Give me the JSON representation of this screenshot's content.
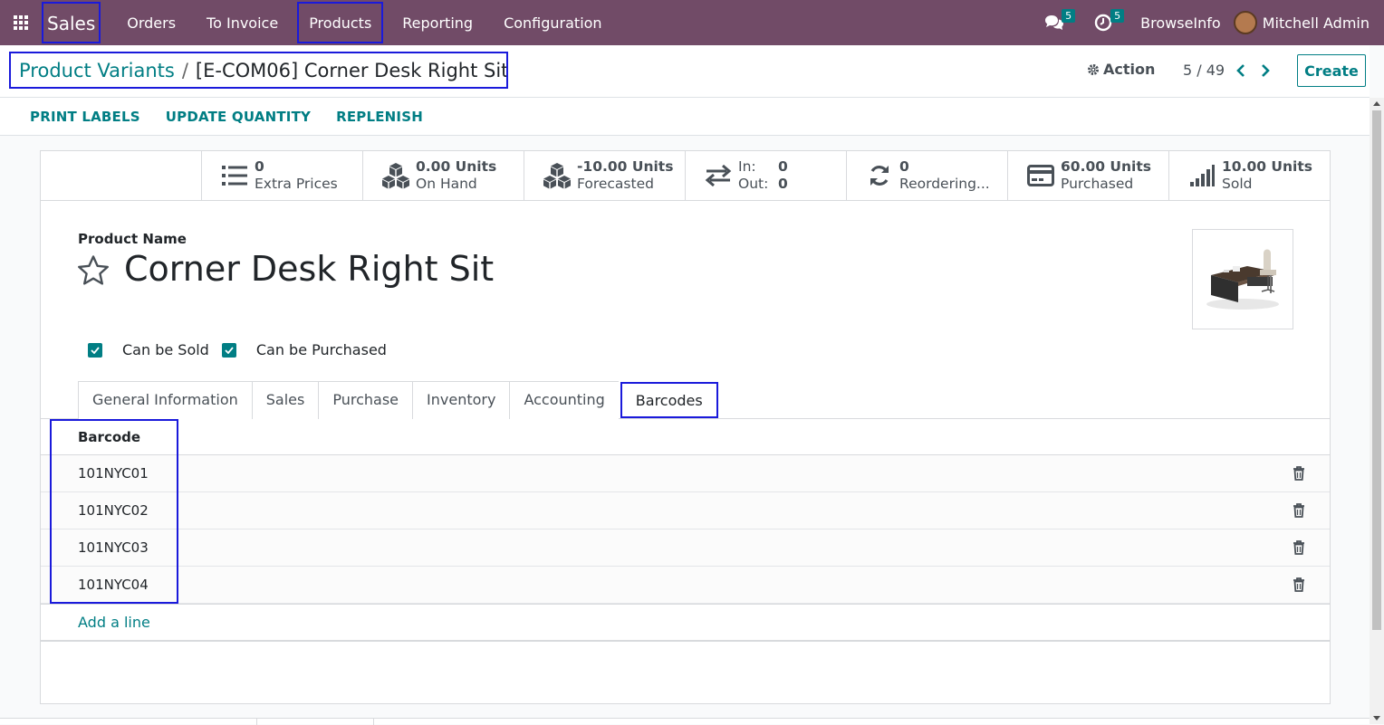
{
  "topbar": {
    "app_name": "Sales",
    "menu": [
      "Orders",
      "To Invoice",
      "Products",
      "Reporting",
      "Configuration"
    ],
    "messages_count": "5",
    "activities_count": "5",
    "company": "BrowseInfo",
    "user": "Mitchell Admin"
  },
  "control": {
    "breadcrumb_parent": "Product Variants",
    "breadcrumb_sep": "/",
    "breadcrumb_current": "[E-COM06] Corner Desk Right Sit",
    "action_label": "Action",
    "pager": "5 / 49",
    "create_label": "Create"
  },
  "statusbar": {
    "buttons": [
      "PRINT LABELS",
      "UPDATE QUANTITY",
      "REPLENISH"
    ]
  },
  "smart_buttons": [
    {
      "icon": "list-icon",
      "value": "0",
      "label": "Extra Prices"
    },
    {
      "icon": "cubes-icon",
      "value": "0.00 Units",
      "label": "On Hand"
    },
    {
      "icon": "cubes-icon",
      "value": "-10.00 Units",
      "label": "Forecasted"
    },
    {
      "icon": "exchange-icon",
      "in_label": "In:",
      "in_value": "0",
      "out_label": "Out:",
      "out_value": "0"
    },
    {
      "icon": "refresh-icon",
      "value": "0",
      "label": "Reordering..."
    },
    {
      "icon": "credit-card-icon",
      "value": "60.00 Units",
      "label": "Purchased"
    },
    {
      "icon": "signal-icon",
      "value": "10.00 Units",
      "label": "Sold"
    }
  ],
  "form": {
    "product_name_label": "Product Name",
    "product_name": "Corner Desk Right Sit",
    "can_be_sold_label": "Can be Sold",
    "can_be_purchased_label": "Can be Purchased"
  },
  "tabs": [
    "General Information",
    "Sales",
    "Purchase",
    "Inventory",
    "Accounting",
    "Barcodes"
  ],
  "barcodes": {
    "column": "Barcode",
    "rows": [
      "101NYC01",
      "101NYC02",
      "101NYC03",
      "101NYC04"
    ],
    "add_line": "Add a line"
  },
  "colors": {
    "topbar": "#714b67",
    "accent": "#017e84",
    "highlight": "#1a1adb"
  }
}
